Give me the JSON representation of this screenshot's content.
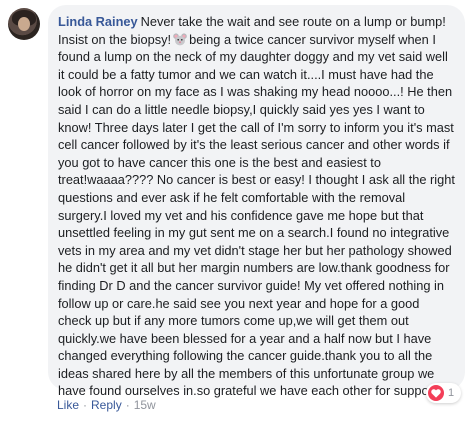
{
  "comment": {
    "author": "Linda Rainey",
    "text_part1": "Never take the wait and see route on a lump or bump! Insist on the biopsy!",
    "emoji_icon": "mouse-face-icon",
    "text_part2": "being a twice cancer survivor myself when I found a lump on the neck of my daughter doggy and my vet said well it could be a fatty tumor and we can watch it....I must have had the look of horror on my face as I was shaking my head noooo...! He then said I can do a little needle biopsy,I quickly said yes yes I want to know! Three days later I get the call of I'm sorry to inform you it's mast cell cancer followed by it's the least serious cancer and other words if you got to have cancer this one is the best and easiest to treat!waaaa???? No cancer is best or easy! I thought I ask all the right questions and ever ask if he felt comfortable with the removal surgery.I loved my vet and his confidence gave me hope but that unsettled feeling in my gut sent me on a search.I found no integrative vets in my area and my vet didn't stage her but her pathology showed he didn't get it all but her margin numbers are low.thank goodness for finding Dr D and the cancer survivor guide! My vet offered nothing in follow up or care.he said see you next year and hope for a good check up but if any more tumors come up,we will get them out quickly.we have been blessed for a year and a half now but I have changed everything following the cancer guide.thank you to all the ideas shared here by all the members of this unfortunate group we have found ourselves in.so grateful we have each other for support."
  },
  "actions": {
    "like": "Like",
    "separator": "·",
    "reply": "Reply",
    "time": "15w"
  },
  "reactions": {
    "icon": "heart-icon",
    "count": "1",
    "color": "#f33e58"
  },
  "colors": {
    "author": "#385898",
    "bubble": "#f2f3f5",
    "text": "#1c1e21",
    "meta": "#90949c"
  }
}
